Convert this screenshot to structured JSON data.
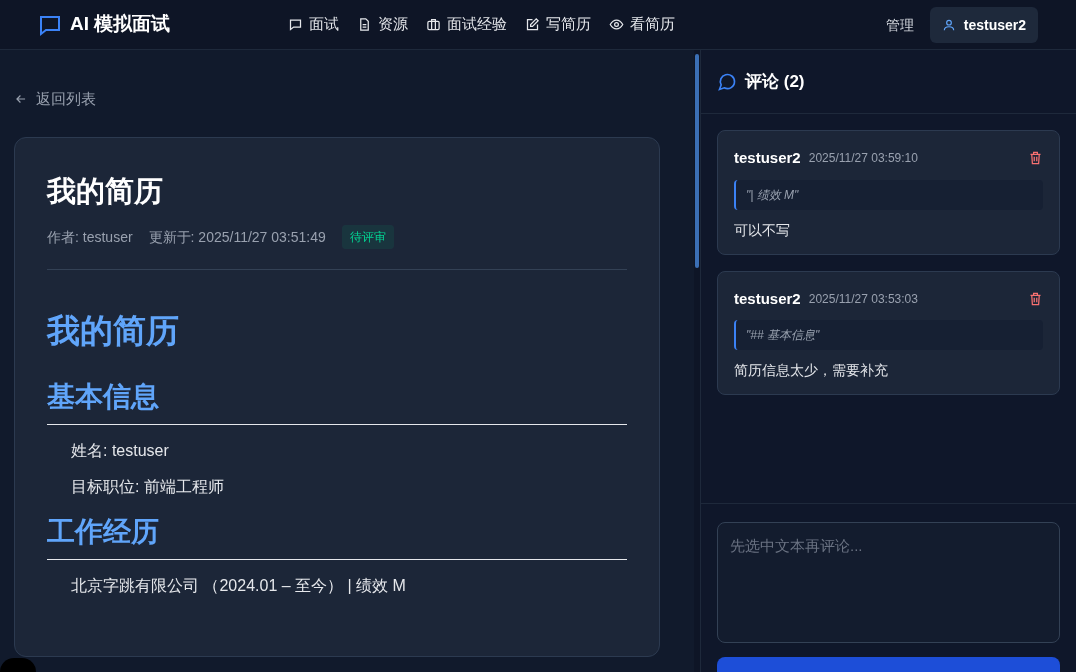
{
  "header": {
    "logo": "AI 模拟面试",
    "nav": [
      {
        "label": "面试"
      },
      {
        "label": "资源"
      },
      {
        "label": "面试经验"
      },
      {
        "label": "写简历"
      },
      {
        "label": "看简历"
      }
    ],
    "admin": "管理",
    "user": "testuser2"
  },
  "back_link": "返回列表",
  "resume": {
    "title": "我的简历",
    "author": "作者: testuser",
    "updated": "更新于: 2025/11/27 03:51:49",
    "status": "待评审",
    "blocks": [
      {
        "kind": "h1",
        "text": "我的简历"
      },
      {
        "kind": "h2",
        "text": "基本信息"
      },
      {
        "kind": "p",
        "text": "姓名: testuser"
      },
      {
        "kind": "p",
        "text": "目标职位: 前端工程师"
      },
      {
        "kind": "h2",
        "text": "工作经历"
      },
      {
        "kind": "p",
        "text": "北京字跳有限公司 （2024.01 – 至今） | 绩效 M"
      }
    ]
  },
  "comments": {
    "title": "评论 (2)",
    "items": [
      {
        "user": "testuser2",
        "time": "2025/11/27 03:59:10",
        "quote": "\"| 绩效 M\"",
        "text": "可以不写"
      },
      {
        "user": "testuser2",
        "time": "2025/11/27 03:53:03",
        "quote": "\"## 基本信息\"",
        "text": "简历信息太少，需要补充"
      }
    ],
    "input": {
      "placeholder": "先选中文本再评论..."
    }
  }
}
